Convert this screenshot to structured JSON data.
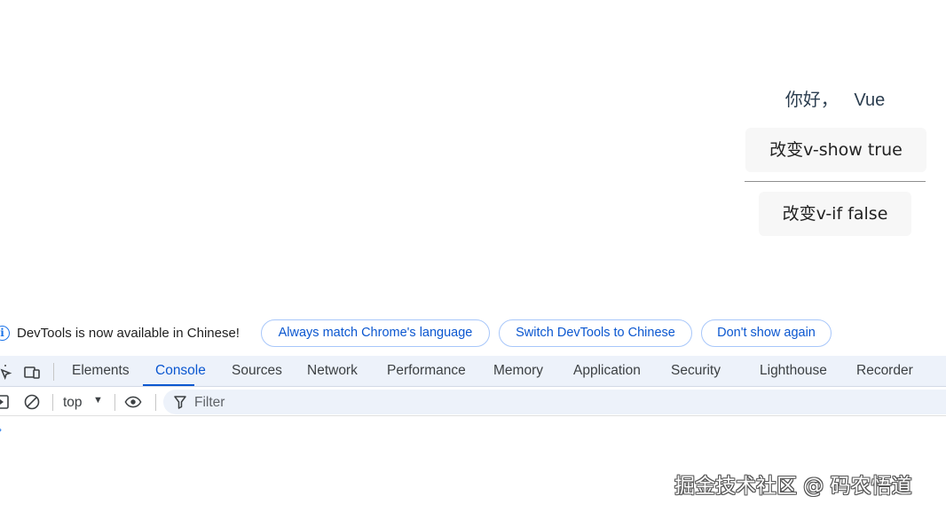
{
  "app": {
    "greeting_prefix": "你好，",
    "greeting_name": "Vue",
    "show_button_label": "改变v-show true",
    "if_button_label": "改变v-if false"
  },
  "devtools": {
    "infobar": {
      "message": "DevTools is now available in Chinese!",
      "always_match_label": "Always match Chrome's language",
      "switch_label": "Switch DevTools to Chinese",
      "dismiss_label": "Don't show again"
    },
    "tabs": [
      {
        "label": "Elements"
      },
      {
        "label": "Console",
        "active": true
      },
      {
        "label": "Sources"
      },
      {
        "label": "Network"
      },
      {
        "label": "Performance"
      },
      {
        "label": "Memory"
      },
      {
        "label": "Application"
      },
      {
        "label": "Security"
      },
      {
        "label": "Lighthouse"
      },
      {
        "label": "Recorder"
      }
    ],
    "console": {
      "context": "top",
      "filter_placeholder": "Filter",
      "prompt": "›"
    },
    "accent_color": "#0b57d0"
  },
  "watermark": "掘金技术社区 @ 码农悟道"
}
